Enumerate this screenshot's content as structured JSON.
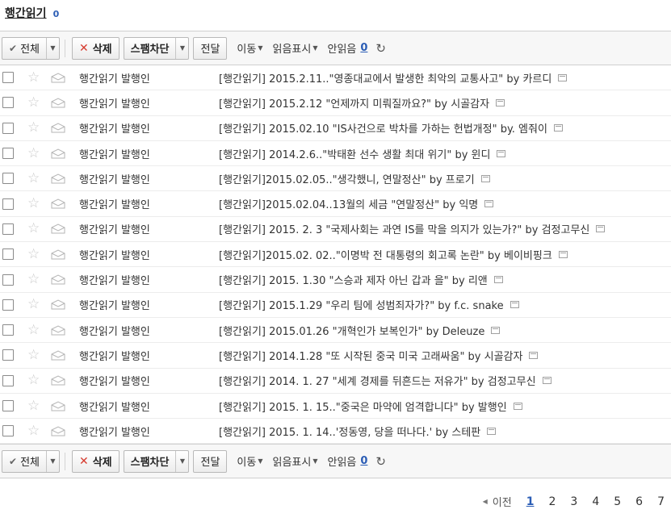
{
  "header": {
    "title": "행간읽기",
    "count": "0"
  },
  "toolbar": {
    "select_all": "전체",
    "delete": "삭제",
    "spam_block": "스팸차단",
    "forward": "전달",
    "move": "이동",
    "mark_read": "읽음표시",
    "unread_label": "안읽음",
    "unread_count": "0"
  },
  "rows": [
    {
      "sender": "행간읽기 발행인",
      "subject": "[행간읽기] 2015.2.11..\"영종대교에서 발생한 최악의 교통사고\" by 카르디"
    },
    {
      "sender": "행간읽기 발행인",
      "subject": "[행간읽기] 2015.2.12 \"언제까지 미뤄질까요?\" by 시골감자"
    },
    {
      "sender": "행간읽기 발행인",
      "subject": "[행간읽기] 2015.02.10 \"IS사건으로 박차를 가하는 헌법개정\" by. 엠줘이"
    },
    {
      "sender": "행간읽기 발행인",
      "subject": "[행간읽기] 2014.2.6..\"박태환 선수 생활 최대 위기\" by 윈디"
    },
    {
      "sender": "행간읽기 발행인",
      "subject": "[행간읽기]2015.02.05..\"생각했니, 연말정산\" by 프로기"
    },
    {
      "sender": "행간읽기 발행인",
      "subject": "[행간읽기]2015.02.04..13월의 세금 \"연말정산\" by 익명"
    },
    {
      "sender": "행간읽기 발행인",
      "subject": "[행간읽기] 2015. 2. 3 \"국제사회는 과연 IS를 막을 의지가 있는가?\" by 검정고무신"
    },
    {
      "sender": "행간읽기 발행인",
      "subject": "[행간읽기]2015.02. 02..\"이명박 전 대통령의 회고록 논란\" by 베이비핑크"
    },
    {
      "sender": "행간읽기 발행인",
      "subject": "[행간읽기] 2015. 1.30 \"스승과 제자 아닌 갑과 을\" by 리앤"
    },
    {
      "sender": "행간읽기 발행인",
      "subject": "[행간읽기] 2015.1.29 \"우리 팀에 성범죄자가?\" by f.c. snake"
    },
    {
      "sender": "행간읽기 발행인",
      "subject": "[행간읽기] 2015.01.26 \"개혁인가 보복인가\" by Deleuze"
    },
    {
      "sender": "행간읽기 발행인",
      "subject": "[행간읽기] 2014.1.28 \"또 시작된 중국 미국 고래싸움\" by 시골감자"
    },
    {
      "sender": "행간읽기 발행인",
      "subject": "[행간읽기] 2014. 1. 27 \"세계 경제를 뒤흔드는 저유가\" by 검정고무신"
    },
    {
      "sender": "행간읽기 발행인",
      "subject": "[행간읽기] 2015. 1. 15..\"중국은 마약에 엄격합니다\" by 발행인"
    },
    {
      "sender": "행간읽기 발행인",
      "subject": "[행간읽기] 2015. 1. 14..'정동영, 당을 떠나다.' by 스테판"
    }
  ],
  "pagination": {
    "prev": "이전",
    "pages": [
      "1",
      "2",
      "3",
      "4",
      "5",
      "6",
      "7"
    ],
    "current": "1"
  },
  "icons": {
    "star": "star-icon",
    "mail": "envelope-icon",
    "refresh": "refresh-icon",
    "new_window": "new-window-icon"
  },
  "colors": {
    "accent": "#2b5db5",
    "delete_x": "#d63b2f"
  }
}
